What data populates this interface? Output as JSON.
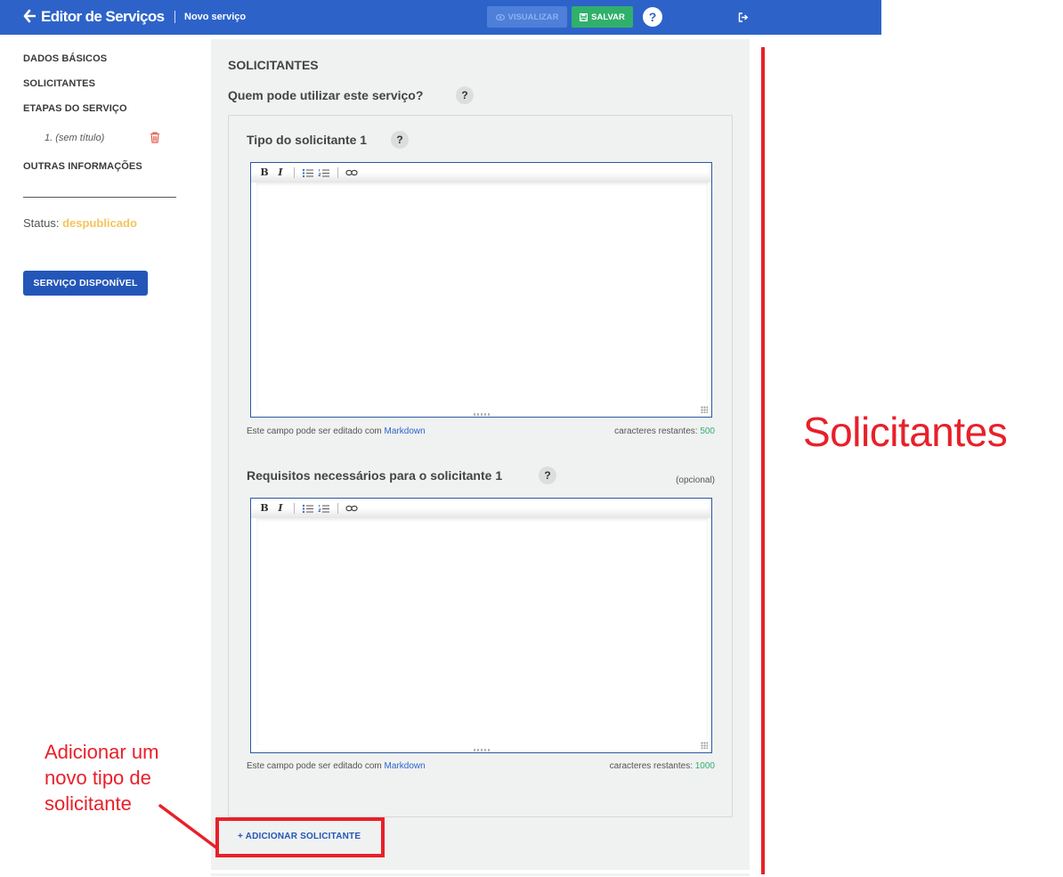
{
  "header": {
    "title": "Editor de Serviços",
    "breadcrumb": "Novo serviço",
    "view_label": "VISUALIZAR",
    "save_label": "SALVAR",
    "help_label": "?",
    "back_icon": "arrow-left-icon",
    "exit_icon": "sign-out-icon",
    "color_bg": "#2d63c9",
    "color_save": "#30b06b"
  },
  "sidebar": {
    "items": [
      {
        "label": "DADOS BÁSICOS"
      },
      {
        "label": "SOLICITANTES"
      },
      {
        "label": "ETAPAS DO SERVIÇO"
      },
      {
        "label": "OUTRAS INFORMAÇÕES"
      }
    ],
    "step_item": "1. (sem título)",
    "delete_icon": "trash-icon",
    "status_label": "Status:",
    "status_value": "despublicado",
    "available_button": "SERVIÇO DISPONÍVEL",
    "color_status": "#f5c45a"
  },
  "main": {
    "section_title": "SOLICITANTES",
    "question": "Quem pode utilizar este serviço?",
    "help": "?",
    "field1": {
      "label": "Tipo do solicitante 1",
      "hint_prefix": "Este campo pode ser editado com",
      "hint_link": "Markdown",
      "counter_label": "caracteres restantes:",
      "counter_value": "500",
      "value": ""
    },
    "field2": {
      "label": "Requisitos necessários para o solicitante 1",
      "optional": "(opcional)",
      "hint_prefix": "Este campo pode ser editado com",
      "hint_link": "Markdown",
      "counter_label": "caracteres restantes:",
      "counter_value": "1000",
      "value": ""
    },
    "toolbar": {
      "bold": "B",
      "italic": "I"
    },
    "add_button": "+ ADICIONAR SOLICITANTE"
  },
  "annotations": {
    "big_label": "Solicitantes",
    "small_label": "Adicionar um novo tipo de solicitante",
    "color": "#e8202a"
  }
}
